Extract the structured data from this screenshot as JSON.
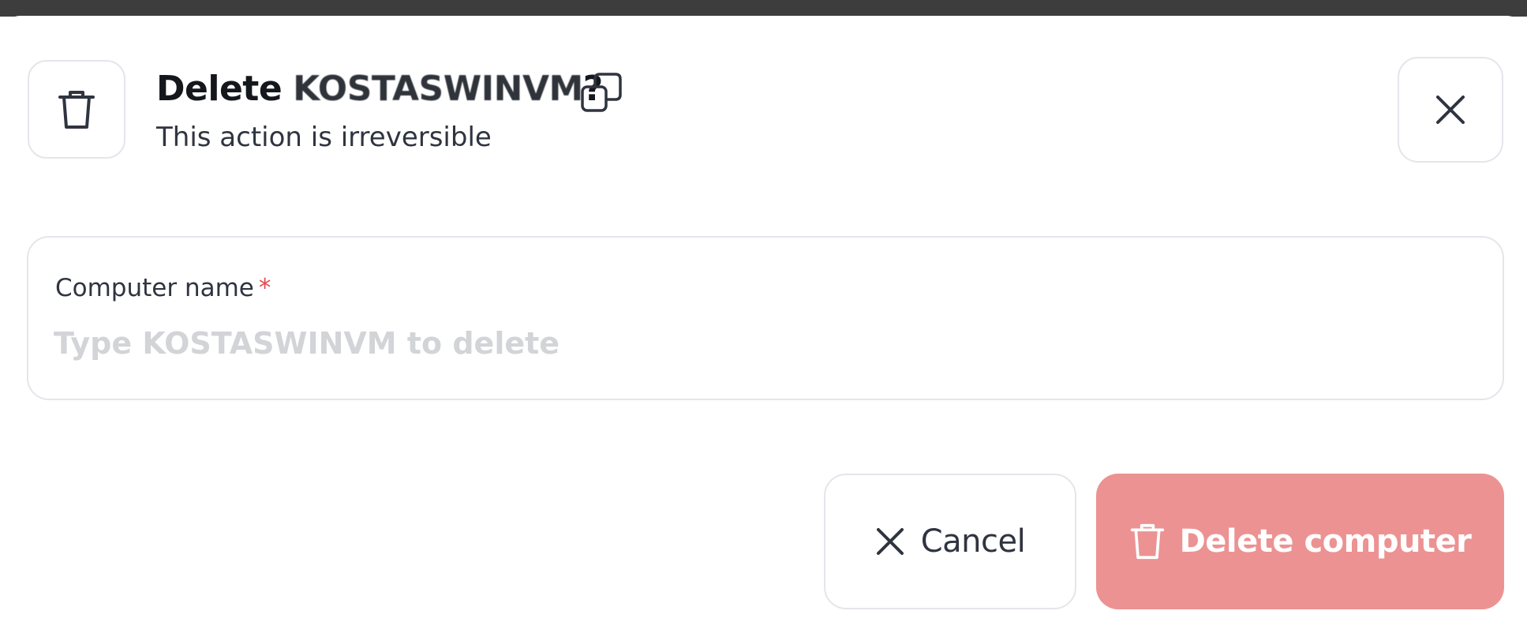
{
  "dialog": {
    "title_prefix": "Delete",
    "computer_name": "KOSTASWINVM",
    "title_suffix": "?",
    "subtitle": "This action is irreversible",
    "header_icon": "trash-icon",
    "copy_icon": "copy-icon",
    "close_icon": "close-icon"
  },
  "field": {
    "label": "Computer name",
    "required_marker": "*",
    "value": "",
    "placeholder": "Type KOSTASWINVM to delete"
  },
  "actions": {
    "cancel_label": "Cancel",
    "cancel_icon": "close-icon",
    "delete_label": "Delete computer",
    "delete_icon": "trash-icon",
    "delete_color": "#ec9292"
  },
  "colors": {
    "topbar": "#3d3d3d",
    "text": "#2f3440",
    "border": "#e3e6ea",
    "required": "#e5484d"
  }
}
